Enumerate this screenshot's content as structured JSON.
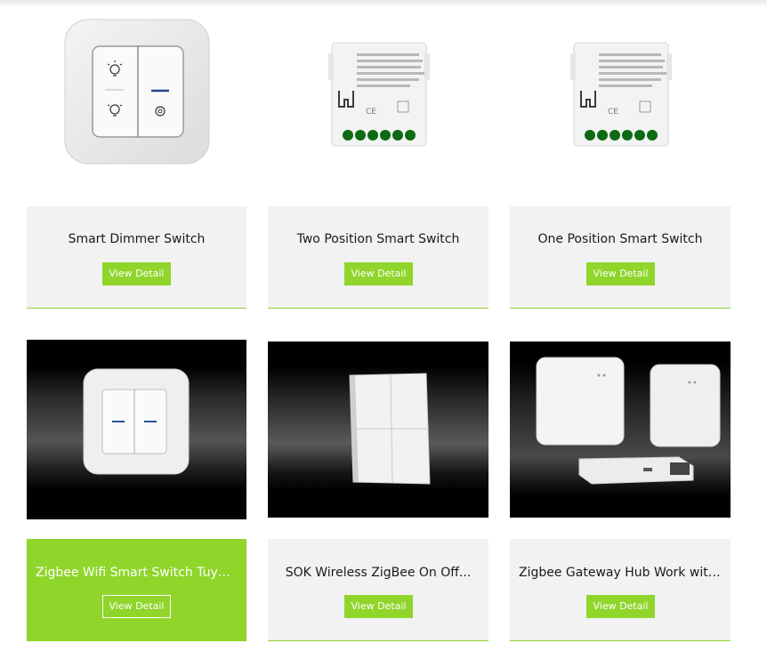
{
  "products": [
    {
      "title": "Smart Dimmer Switch",
      "button": "View Detail",
      "image": "dimmer-switch-panel"
    },
    {
      "title": "Two Position Smart Switch",
      "button": "View Detail",
      "image": "relay-module"
    },
    {
      "title": "One Position Smart Switch",
      "button": "View Detail",
      "image": "relay-module"
    },
    {
      "title": "Zigbee Wifi Smart Switch Tuya ...",
      "button": "View Detail",
      "image": "two-gang-switch-dark"
    },
    {
      "title": "SOK Wireless ZigBee On Off...",
      "button": "View Detail",
      "image": "four-gang-switch-dark"
    },
    {
      "title": "Zigbee Gateway Hub Work with..",
      "button": "View Detail",
      "image": "gateway-hubs-dark"
    }
  ],
  "colors": {
    "accent": "#8fd52a",
    "card_bg": "#f2f2f2",
    "text": "#1a1a1a"
  }
}
